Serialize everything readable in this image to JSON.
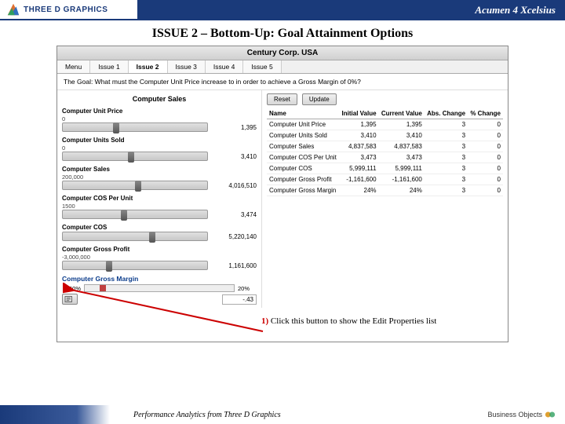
{
  "header": {
    "logo_text": "THREE D GRAPHICS",
    "product": "Acumen 4 Xcelsius"
  },
  "slide_title": "ISSUE 2 – Bottom-Up: Goal Attainment Options",
  "app": {
    "title": "Century Corp. USA",
    "tabs": [
      "Menu",
      "Issue 1",
      "Issue 2",
      "Issue 3",
      "Issue 4",
      "Issue 5"
    ],
    "active_tab": 2,
    "goal_line": "The Goal: What must the Computer Unit Price increase to in order to achieve a Gross Margin of 0%?",
    "section": "Computer Sales",
    "sliders": [
      {
        "label": "Computer Unit Price",
        "left": "0",
        "value": "1,395",
        "thumb": 35
      },
      {
        "label": "Computer Units Sold",
        "left": "0",
        "value": "3,410",
        "thumb": 45
      },
      {
        "label": "Computer Sales",
        "left": "200,000",
        "value": "4,016,510",
        "thumb": 50
      },
      {
        "label": "Computer COS Per Unit",
        "left": "1500",
        "value": "3,474",
        "thumb": 40
      },
      {
        "label": "Computer COS",
        "left": "",
        "value": "5,220,140",
        "thumb": 60
      },
      {
        "label": "Computer Gross Profit",
        "left": "-3,000,000",
        "value": "1,161,600",
        "thumb": 30
      }
    ],
    "gm": {
      "label": "Computer Gross Margin",
      "left": "-50%",
      "right": "20%",
      "value": "-.43"
    },
    "buttons": {
      "reset": "Reset",
      "update": "Update"
    },
    "table": {
      "cols": [
        "Name",
        "Initial Value",
        "Current Value",
        "Abs. Change",
        "% Change"
      ],
      "rows": [
        [
          "Computer Unit Price",
          "1,395",
          "1,395",
          "3",
          "0"
        ],
        [
          "Computer Units Sold",
          "3,410",
          "3,410",
          "3",
          "0"
        ],
        [
          "Computer Sales",
          "4,837,583",
          "4,837,583",
          "3",
          "0"
        ],
        [
          "Computer COS Per Unit",
          "3,473",
          "3,473",
          "3",
          "0"
        ],
        [
          "Computer COS",
          "5,999,111",
          "5,999,111",
          "3",
          "0"
        ],
        [
          "Computer Gross Profit",
          "-1,161,600",
          "-1,161,600",
          "3",
          "0"
        ],
        [
          "Computer Gross Margin",
          "24%",
          "24%",
          "3",
          "0"
        ]
      ]
    }
  },
  "callout": {
    "num": "1)",
    "text": " Click this button to show the Edit Properties list"
  },
  "footer": {
    "text": "Performance Analytics from Three D Graphics",
    "brand": "Business Objects"
  }
}
